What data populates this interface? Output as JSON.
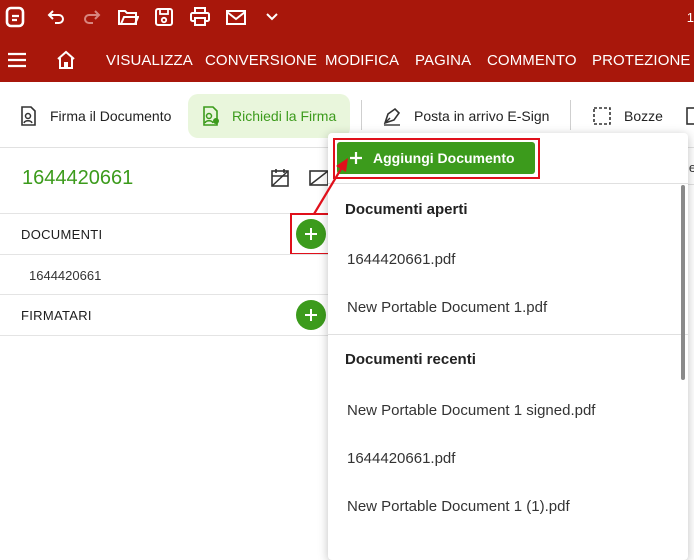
{
  "titlebar": {
    "icons": [
      "app-logo-icon",
      "undo-icon",
      "redo-icon",
      "open-folder-icon",
      "save-icon",
      "print-icon",
      "mail-icon",
      "chevron-down-icon"
    ],
    "page_number": "1"
  },
  "menu": {
    "items": [
      "VISUALIZZA",
      "CONVERSIONE",
      "MODIFICA",
      "PAGINA",
      "COMMENTO",
      "PROTEZIONE"
    ]
  },
  "toolbar": {
    "sign_document": "Firma il Documento",
    "request_signature": "Richiedi la Firma",
    "esign_inbox": "Posta in arrivo E-Sign",
    "drafts": "Bozze"
  },
  "left_panel": {
    "document_title": "1644420661",
    "documents_label": "DOCUMENTI",
    "document_item": "1644420661",
    "signers_label": "FIRMATARI"
  },
  "dropdown": {
    "add_document_label": "Aggiungi Documento",
    "open_documents_header": "Documenti aperti",
    "open_documents": [
      "1644420661.pdf",
      "New Portable Document 1.pdf"
    ],
    "recent_documents_header": "Documenti recenti",
    "recent_documents": [
      "New Portable Document 1 signed.pdf",
      "1644420661.pdf",
      "New Portable Document 1 (1).pdf"
    ]
  },
  "colors": {
    "brand_red": "#a8170b",
    "accent_green": "#3c9b1c",
    "highlight_red": "#e0101b"
  }
}
